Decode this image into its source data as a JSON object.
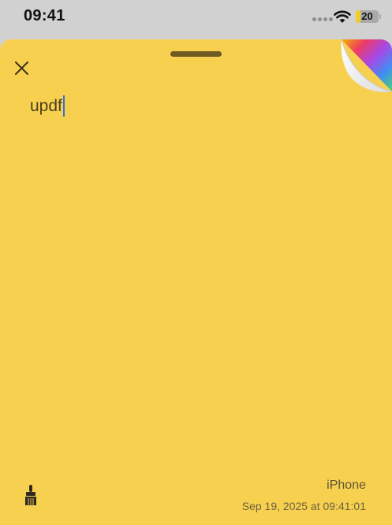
{
  "status_bar": {
    "time": "09:41",
    "battery_level": "20",
    "battery_fraction": 0.2,
    "icons": [
      "cellular-dots-icon",
      "wifi-icon",
      "battery-icon"
    ]
  },
  "note": {
    "text": "updf",
    "device": "iPhone",
    "timestamp": "Sep 19, 2025 at 09:41:01",
    "background_color": "#f8d04f"
  },
  "controls": {
    "close_icon": "close-icon",
    "brush_icon": "paintbrush-icon",
    "color_peel_icon": "color-peel-icon",
    "caret_color": "#2f6fe0"
  }
}
